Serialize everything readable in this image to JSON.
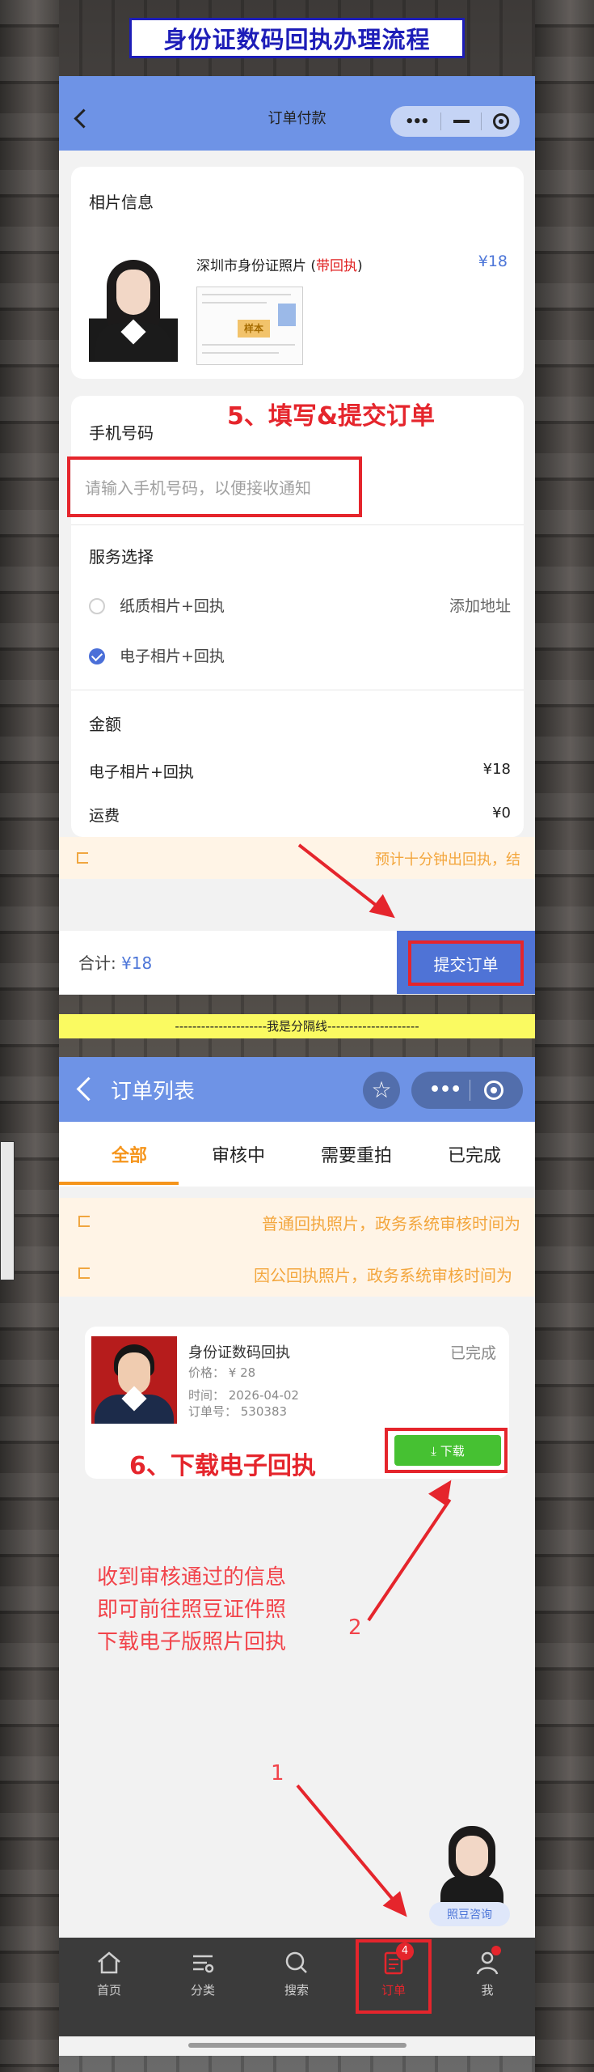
{
  "title": "身份证数码回执办理流程",
  "step1": {
    "nav_title": "订单付款",
    "photo_section_title": "相片信息",
    "product_name_prefix": "深圳市身份证照片 (",
    "product_name_tag": "带回执",
    "product_name_suffix": ")",
    "product_price": "¥18",
    "receipt_stamp": "样本",
    "annotation": "5、填写&提交订单",
    "phone_label": "手机号码",
    "phone_placeholder": "请输入手机号码，以便接收通知",
    "service_title": "服务选择",
    "options": [
      {
        "label": "纸质相片+回执",
        "selected": false
      },
      {
        "label": "电子相片+回执",
        "selected": true
      }
    ],
    "add_address": "添加地址",
    "amount_title": "金额",
    "amount_items": [
      {
        "label": "电子相片+回执",
        "value": "¥18"
      },
      {
        "label": "运费",
        "value": "¥0"
      }
    ],
    "notice": "预计十分钟出回执，结",
    "total_label": "合计: ",
    "total_value": "¥18",
    "submit_label": "提交订单"
  },
  "separator": "---------------------我是分隔线---------------------",
  "step2": {
    "nav_title": "订单列表",
    "tabs": [
      "全部",
      "审核中",
      "需要重拍",
      "已完成"
    ],
    "active_tab": 0,
    "notices": [
      "普通回执照片，政务系统审核时间为",
      "因公回执照片，政务系统审核时间为"
    ],
    "order": {
      "title": "身份证数码回执",
      "status": "已完成",
      "price": "价格： ¥ 28",
      "time": "时间： 2026-04-02",
      "order_no": "订单号： 530383",
      "download_label": "⤓ 下载"
    },
    "annotation": "6、下载电子回执",
    "explain": "收到审核通过的信息\n即可前往照豆证件照\n下载电子版照片回执",
    "label_1": "1",
    "label_2": "2",
    "support_label": "照豆咨询",
    "tabbar": [
      {
        "label": "首页",
        "icon": "home-icon"
      },
      {
        "label": "分类",
        "icon": "category-icon"
      },
      {
        "label": "搜索",
        "icon": "search-icon"
      },
      {
        "label": "订单",
        "icon": "order-icon",
        "badge": "4",
        "active": true
      },
      {
        "label": "我",
        "icon": "user-icon"
      }
    ]
  },
  "colors": {
    "nav_blue": "#6e93e6",
    "annotation_red": "#e5252c",
    "accent_orange": "#f5951c",
    "title_blue": "#1d1db8"
  }
}
